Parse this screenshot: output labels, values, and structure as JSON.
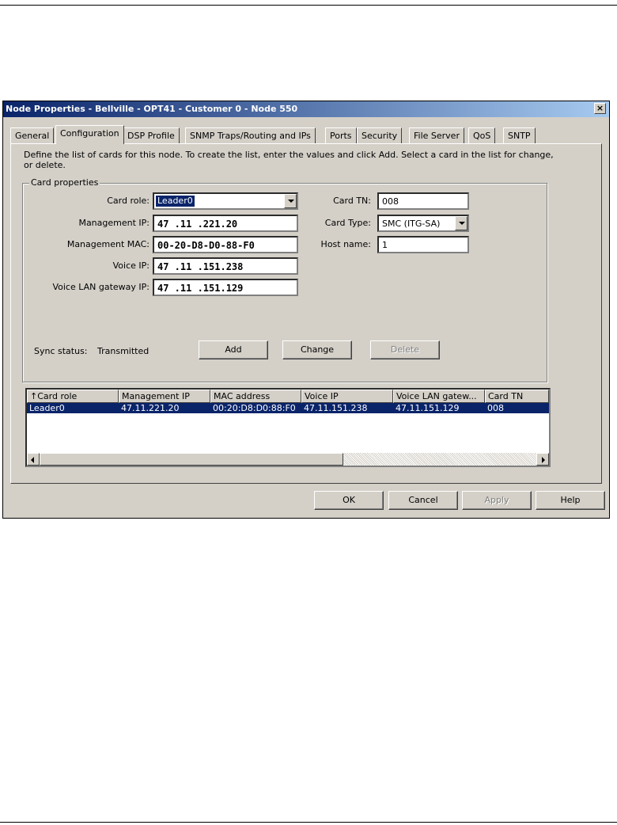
{
  "window": {
    "title": "Node Properties - Bellville - OPT41 - Customer 0 - Node 550",
    "close_label": "×"
  },
  "tabs": [
    "General",
    "Configuration",
    "DSP Profile",
    "SNMP Traps/Routing and IPs",
    "Ports",
    "Security",
    "File Server",
    "QoS",
    "SNTP"
  ],
  "active_tab": "Configuration",
  "description": "Define the list of cards for this node.  To create the list, enter the values and click Add.  Select a card in the list for change, or delete.",
  "card_properties": {
    "group_label": "Card properties",
    "card_role_label": "Card role:",
    "card_role_value": "Leader0",
    "management_ip_label": "Management IP:",
    "management_ip_value": "47 .11 .221.20",
    "management_mac_label": "Management MAC:",
    "management_mac_value": "00-20-D8-D0-88-F0",
    "voice_ip_label": "Voice IP:",
    "voice_ip_value": "47 .11 .151.238",
    "voice_gateway_label": "Voice LAN gateway IP:",
    "voice_gateway_value": "47 .11 .151.129",
    "card_tn_label": "Card TN:",
    "card_tn_value": "008",
    "card_type_label": "Card Type:",
    "card_type_value": "SMC (ITG-SA)",
    "host_name_label": "Host name:",
    "host_name_value": "1",
    "sync_status_label": "Sync status:",
    "sync_status_value": "Transmitted",
    "add_label": "Add",
    "change_label": "Change",
    "delete_label": "Delete"
  },
  "card_list": {
    "columns": [
      "↑Card role",
      "Management IP",
      "MAC address",
      "Voice IP",
      "Voice LAN gatew...",
      "Card TN"
    ],
    "rows": [
      [
        "Leader0",
        "47.11.221.20",
        "00:20:D8:D0:88:F0",
        "47.11.151.238",
        "47.11.151.129",
        "008"
      ]
    ]
  },
  "buttons": {
    "ok": "OK",
    "cancel": "Cancel",
    "apply": "Apply",
    "help": "Help"
  }
}
